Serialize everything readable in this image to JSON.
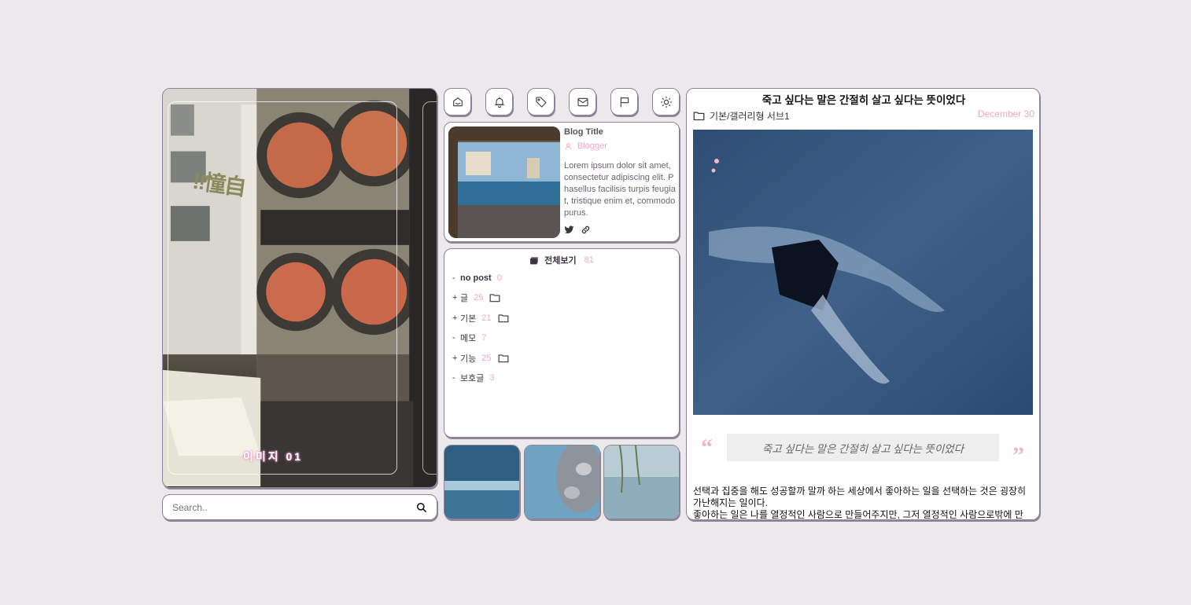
{
  "hero": {
    "caption": "이미지 01",
    "sticker": "!!憧自"
  },
  "search": {
    "placeholder": "Search.."
  },
  "toolbar": {
    "icons": [
      "home-icon",
      "bell-icon",
      "tag-icon",
      "mail-icon",
      "flag-icon",
      "sun-icon"
    ]
  },
  "profile": {
    "blog_title": "Blog Title",
    "blogger": "Blogger",
    "description": "Lorem ipsum dolor sit amet, consectetur adipiscing elit. Phasellus facilisis turpis feugiat, tristique enim et, commodo purus."
  },
  "categories": {
    "header_label": "전체보기",
    "header_count": "81",
    "items": [
      {
        "mark": "-",
        "name": "no post",
        "count": "0",
        "bold": true,
        "folder": false
      },
      {
        "mark": "+",
        "name": "글",
        "count": "25",
        "bold": false,
        "folder": true
      },
      {
        "mark": "+",
        "name": "기본",
        "count": "21",
        "bold": false,
        "folder": true
      },
      {
        "mark": "-",
        "name": "메모",
        "count": "7",
        "bold": false,
        "folder": false
      },
      {
        "mark": "+",
        "name": "기능",
        "count": "25",
        "bold": false,
        "folder": true
      },
      {
        "mark": "-",
        "name": "보호글",
        "count": "3",
        "bold": false,
        "folder": false
      }
    ]
  },
  "post": {
    "title": "죽고 싶다는 말은 간절히 살고 싶다는 뜻이었다",
    "category": "기본/갤러리형 서브1",
    "date": "December 30",
    "quote": "죽고 싶다는 말은 간절히 살고 싶다는 뜻이었다",
    "body_line1": "선택과 집중을 해도 성공할까 말까 하는 세상에서 좋아하는 일을 선택하는 것은 굉장히 가난해지는 일이다.",
    "body_line2": "좋아하는 일은 나를 열정적인 사람으로 만들어주지만, 그저 열정적인 사람으로밖에 만"
  },
  "colors": {
    "accent_pink": "#f0a6c4",
    "border": "#8e8497",
    "background": "#ebe9ec"
  }
}
